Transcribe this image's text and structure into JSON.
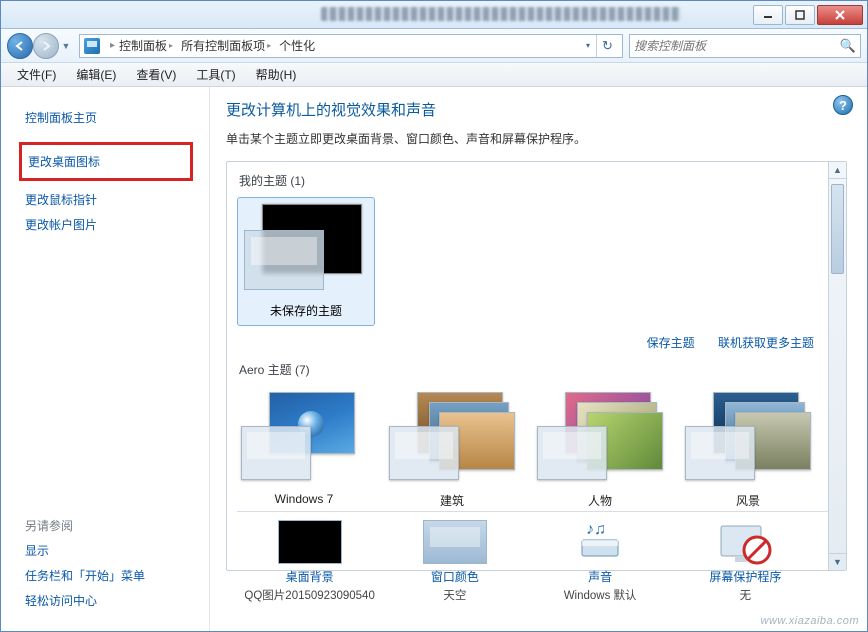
{
  "window_controls": {
    "minimize": "min",
    "maximize": "max",
    "close": "close"
  },
  "breadcrumb": {
    "root": "控制面板",
    "mid": "所有控制面板项",
    "leaf": "个性化"
  },
  "search": {
    "placeholder": "搜索控制面板"
  },
  "menubar": {
    "file": "文件(F)",
    "edit": "编辑(E)",
    "view": "查看(V)",
    "tools": "工具(T)",
    "help": "帮助(H)"
  },
  "sidebar": {
    "home": "控制面板主页",
    "links": {
      "desktop_icons": "更改桌面图标",
      "mouse_pointers": "更改鼠标指针",
      "account_picture": "更改帐户图片"
    },
    "see_also_header": "另请参阅",
    "see_also": {
      "display": "显示",
      "taskbar": "任务栏和「开始」菜单",
      "ease": "轻松访问中心"
    }
  },
  "main": {
    "heading": "更改计算机上的视觉效果和声音",
    "sub": "单击某个主题立即更改桌面背景、窗口颜色、声音和屏幕保护程序。",
    "my_themes_header": "我的主题 (1)",
    "my_theme_name": "未保存的主题",
    "save_theme": "保存主题",
    "get_more": "联机获取更多主题",
    "aero_header": "Aero 主题 (7)",
    "aero": {
      "win7": "Windows 7",
      "arch": "建筑",
      "ppl": "人物",
      "land": "风景"
    },
    "bottom": {
      "bg_label": "桌面背景",
      "bg_sub": "QQ图片20150923090540",
      "color_label": "窗口颜色",
      "color_sub": "天空",
      "sound_label": "声音",
      "sound_sub": "Windows 默认",
      "ss_label": "屏幕保护程序",
      "ss_sub": "无"
    }
  },
  "watermark": "www.xiazaiba.com"
}
